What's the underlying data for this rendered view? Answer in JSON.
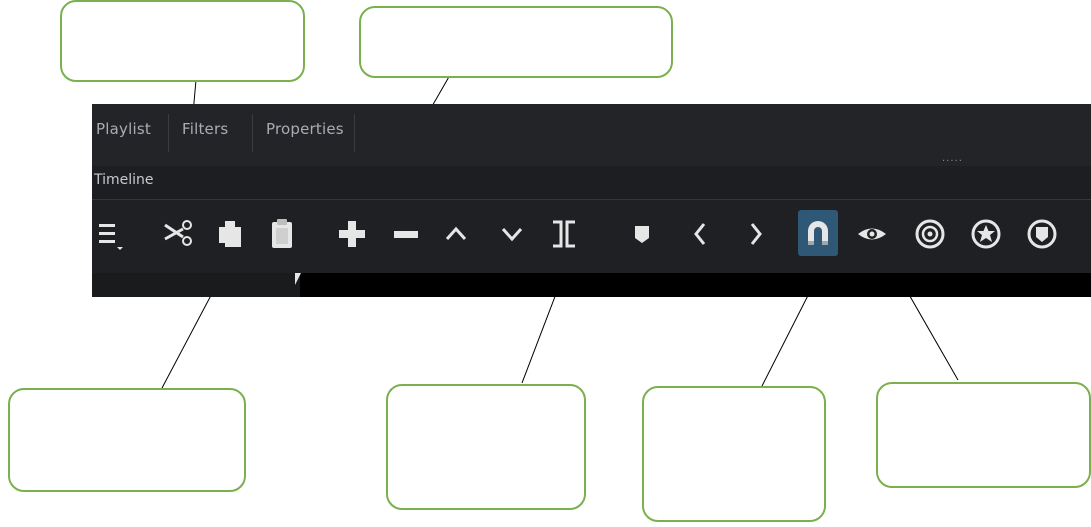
{
  "tabs": [
    "Playlist",
    "Filters",
    "Properties"
  ],
  "header_dots": "·····",
  "timeline": {
    "label": "Timeline"
  },
  "toolbar": {
    "buttons": [
      "menu-icon",
      "cut-icon",
      "copy-icon",
      "paste-icon",
      "append-icon",
      "remove-icon",
      "lift-icon",
      "overwrite-icon",
      "split-icon",
      "marker-icon",
      "previous-marker-icon",
      "next-marker-icon",
      "snap-icon",
      "scrub-icon",
      "ripple-icon",
      "ripple-all-icon",
      "ripple-markers-icon"
    ],
    "active": "snap-icon",
    "icon_color": "#e6e6e6",
    "active_color": "#2f5876"
  },
  "colors": {
    "callout_border": "#7ab04e",
    "panel_bg": "#1d1e21",
    "tab_text": "#a9adb3"
  }
}
